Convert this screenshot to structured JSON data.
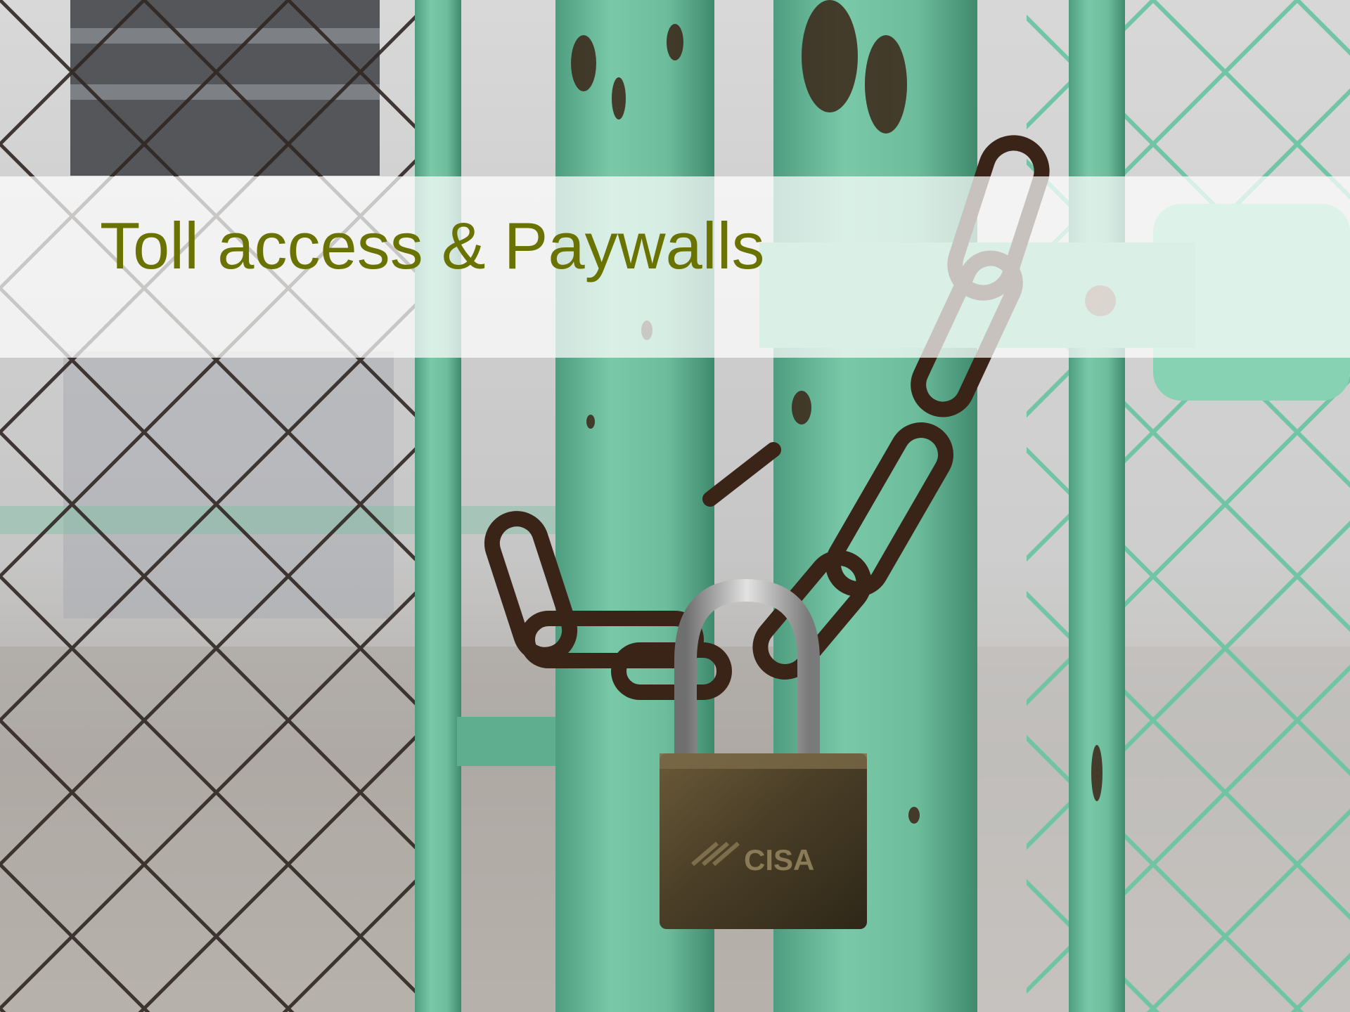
{
  "slide": {
    "title": "Toll access & Paywalls",
    "title_color": "#6b7300",
    "band_color": "rgba(255,255,255,0.72)"
  },
  "photo": {
    "subject_icon": "padlock-on-chained-gate-icon",
    "padlock_brand_text": "CISA",
    "palette": {
      "gate_green": "#6fc4a2",
      "rust": "#3a2418",
      "background_grey": "#c9c9c9"
    }
  }
}
